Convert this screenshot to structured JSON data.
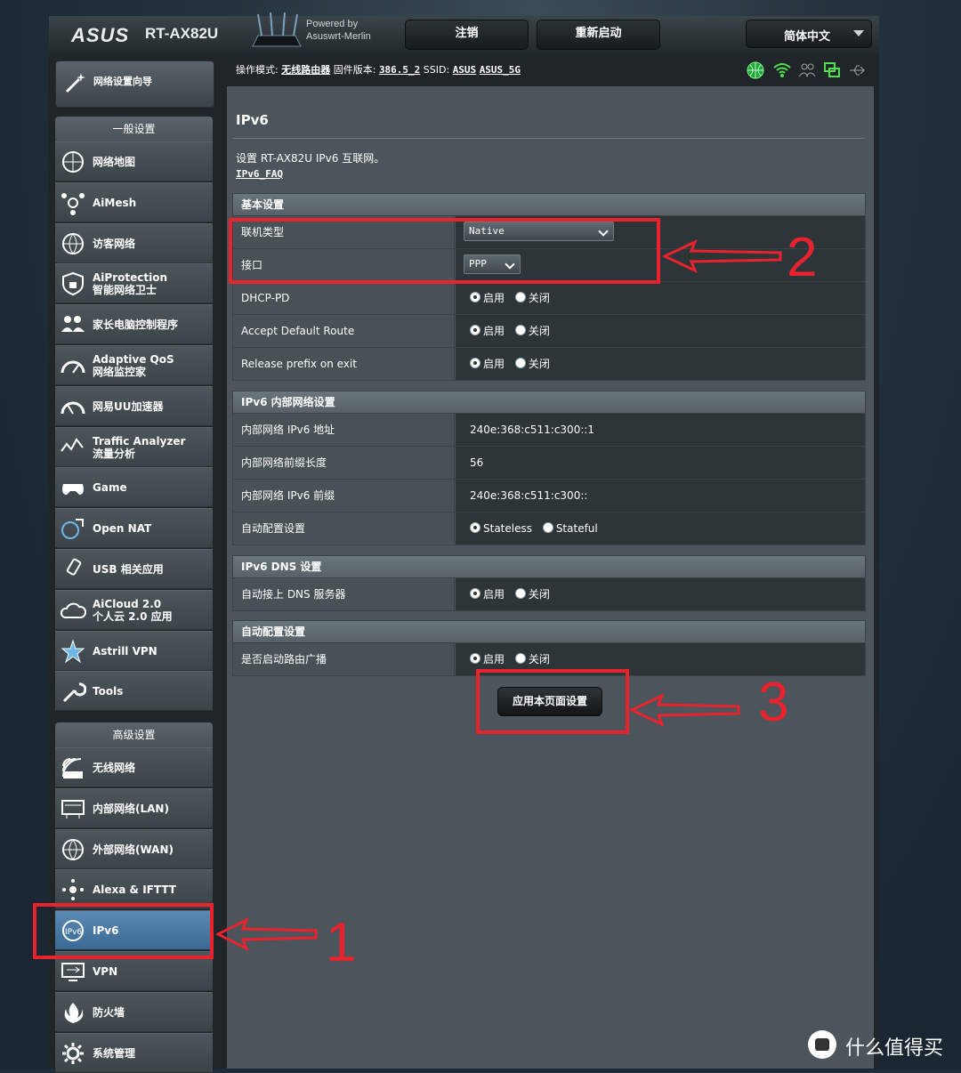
{
  "header": {
    "brand": "ASUS",
    "model": "RT-AX82U",
    "powered_line1": "Powered by",
    "powered_line2": "Asuswrt-Merlin",
    "logout": "注销",
    "reboot": "重新启动",
    "language": "简体中文"
  },
  "status": {
    "mode_label": "操作模式:",
    "mode_value": "无线路由器",
    "fw_label": "固件版本:",
    "fw_value": "386.5_2",
    "ssid_label": "SSID:",
    "ssid1": "ASUS",
    "ssid2": "ASUS_5G"
  },
  "sidebar": {
    "wizard": "网络设置向导",
    "general_header": "一般设置",
    "general": [
      {
        "line1": "网络地图",
        "line2": ""
      },
      {
        "line1": "AiMesh",
        "line2": ""
      },
      {
        "line1": "访客网络",
        "line2": ""
      },
      {
        "line1": "AiProtection",
        "line2": "智能网络卫士"
      },
      {
        "line1": "家长电脑控制程序",
        "line2": ""
      },
      {
        "line1": "Adaptive QoS",
        "line2": "网络监控家"
      },
      {
        "line1": "网易UU加速器",
        "line2": ""
      },
      {
        "line1": "Traffic Analyzer",
        "line2": "流量分析"
      },
      {
        "line1": "Game",
        "line2": ""
      },
      {
        "line1": "Open NAT",
        "line2": ""
      },
      {
        "line1": "USB 相关应用",
        "line2": ""
      },
      {
        "line1": "AiCloud 2.0",
        "line2": "个人云 2.0 应用"
      },
      {
        "line1": "Astrill VPN",
        "line2": ""
      },
      {
        "line1": "Tools",
        "line2": ""
      }
    ],
    "advanced_header": "高级设置",
    "advanced": [
      {
        "line1": "无线网络"
      },
      {
        "line1": "内部网络(LAN)"
      },
      {
        "line1": "外部网络(WAN)"
      },
      {
        "line1": "Alexa & IFTTT"
      },
      {
        "line1": "IPv6"
      },
      {
        "line1": "VPN"
      },
      {
        "line1": "防火墙"
      },
      {
        "line1": "系统管理"
      }
    ]
  },
  "page": {
    "title": "IPv6",
    "description": "设置 RT-AX82U IPv6 互联网。",
    "faq": "IPv6_FAQ",
    "opt_on": "启用",
    "opt_off": "关闭",
    "basic_header": "基本设置",
    "conn_type_label": "联机类型",
    "conn_type_value": "Native",
    "interface_label": "接口",
    "interface_value": "PPP",
    "dhcp_pd": "DHCP-PD",
    "accept_route": "Accept Default Route",
    "release_prefix": "Release prefix on exit",
    "lan_header": "IPv6 内部网络设置",
    "lan_addr_label": "内部网络 IPv6 地址",
    "lan_addr_value": "240e:368:c511:c300::1",
    "prefix_len_label": "内部网络前缀长度",
    "prefix_len_value": "56",
    "prefix_label": "内部网络 IPv6 前缀",
    "prefix_value": "240e:368:c511:c300::",
    "autoconf_label": "自动配置设置",
    "stateless": "Stateless",
    "stateful": "Stateful",
    "dns_header": "IPv6 DNS 设置",
    "dns_auto_label": "自动接上 DNS 服务器",
    "auto_header": "自动配置设置",
    "router_adv_label": "是否启动路由广播",
    "apply": "应用本页面设置"
  },
  "annotations": {
    "n1": "1",
    "n2": "2",
    "n3": "3",
    "color": "#e8232e"
  },
  "watermark": "什么值得买"
}
